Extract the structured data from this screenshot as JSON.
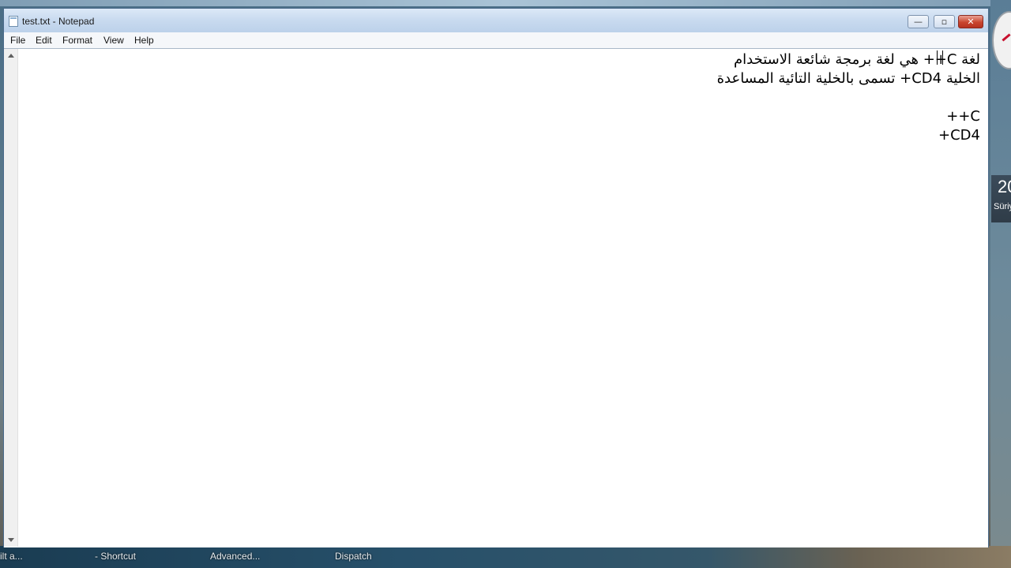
{
  "window": {
    "title": "test.txt - Notepad",
    "minimize_glyph": "—",
    "maximize_glyph": "▫",
    "close_glyph": "✕"
  },
  "menu": {
    "items": [
      {
        "label": "File"
      },
      {
        "label": "Edit"
      },
      {
        "label": "Format"
      },
      {
        "label": "View"
      },
      {
        "label": "Help"
      }
    ]
  },
  "document": {
    "lines": [
      "لغة C++ هي لغة برمجة شائعة الاستخدام",
      "الخلية CD4+ تسمى بالخلية التائية المساعدة",
      "",
      "C++",
      "CD4+"
    ]
  },
  "taskbar": {
    "items": [
      {
        "label": "ilt a..."
      },
      {
        "label": "- Shortcut"
      },
      {
        "label": "Advanced..."
      },
      {
        "label": "Dispatch"
      }
    ]
  },
  "gadgets": {
    "weather_temp": "20",
    "weather_city": "Süriy"
  },
  "icons": {
    "app": "notepad-icon",
    "scroll_up": "arrow-up-icon",
    "scroll_down": "arrow-down-icon"
  }
}
